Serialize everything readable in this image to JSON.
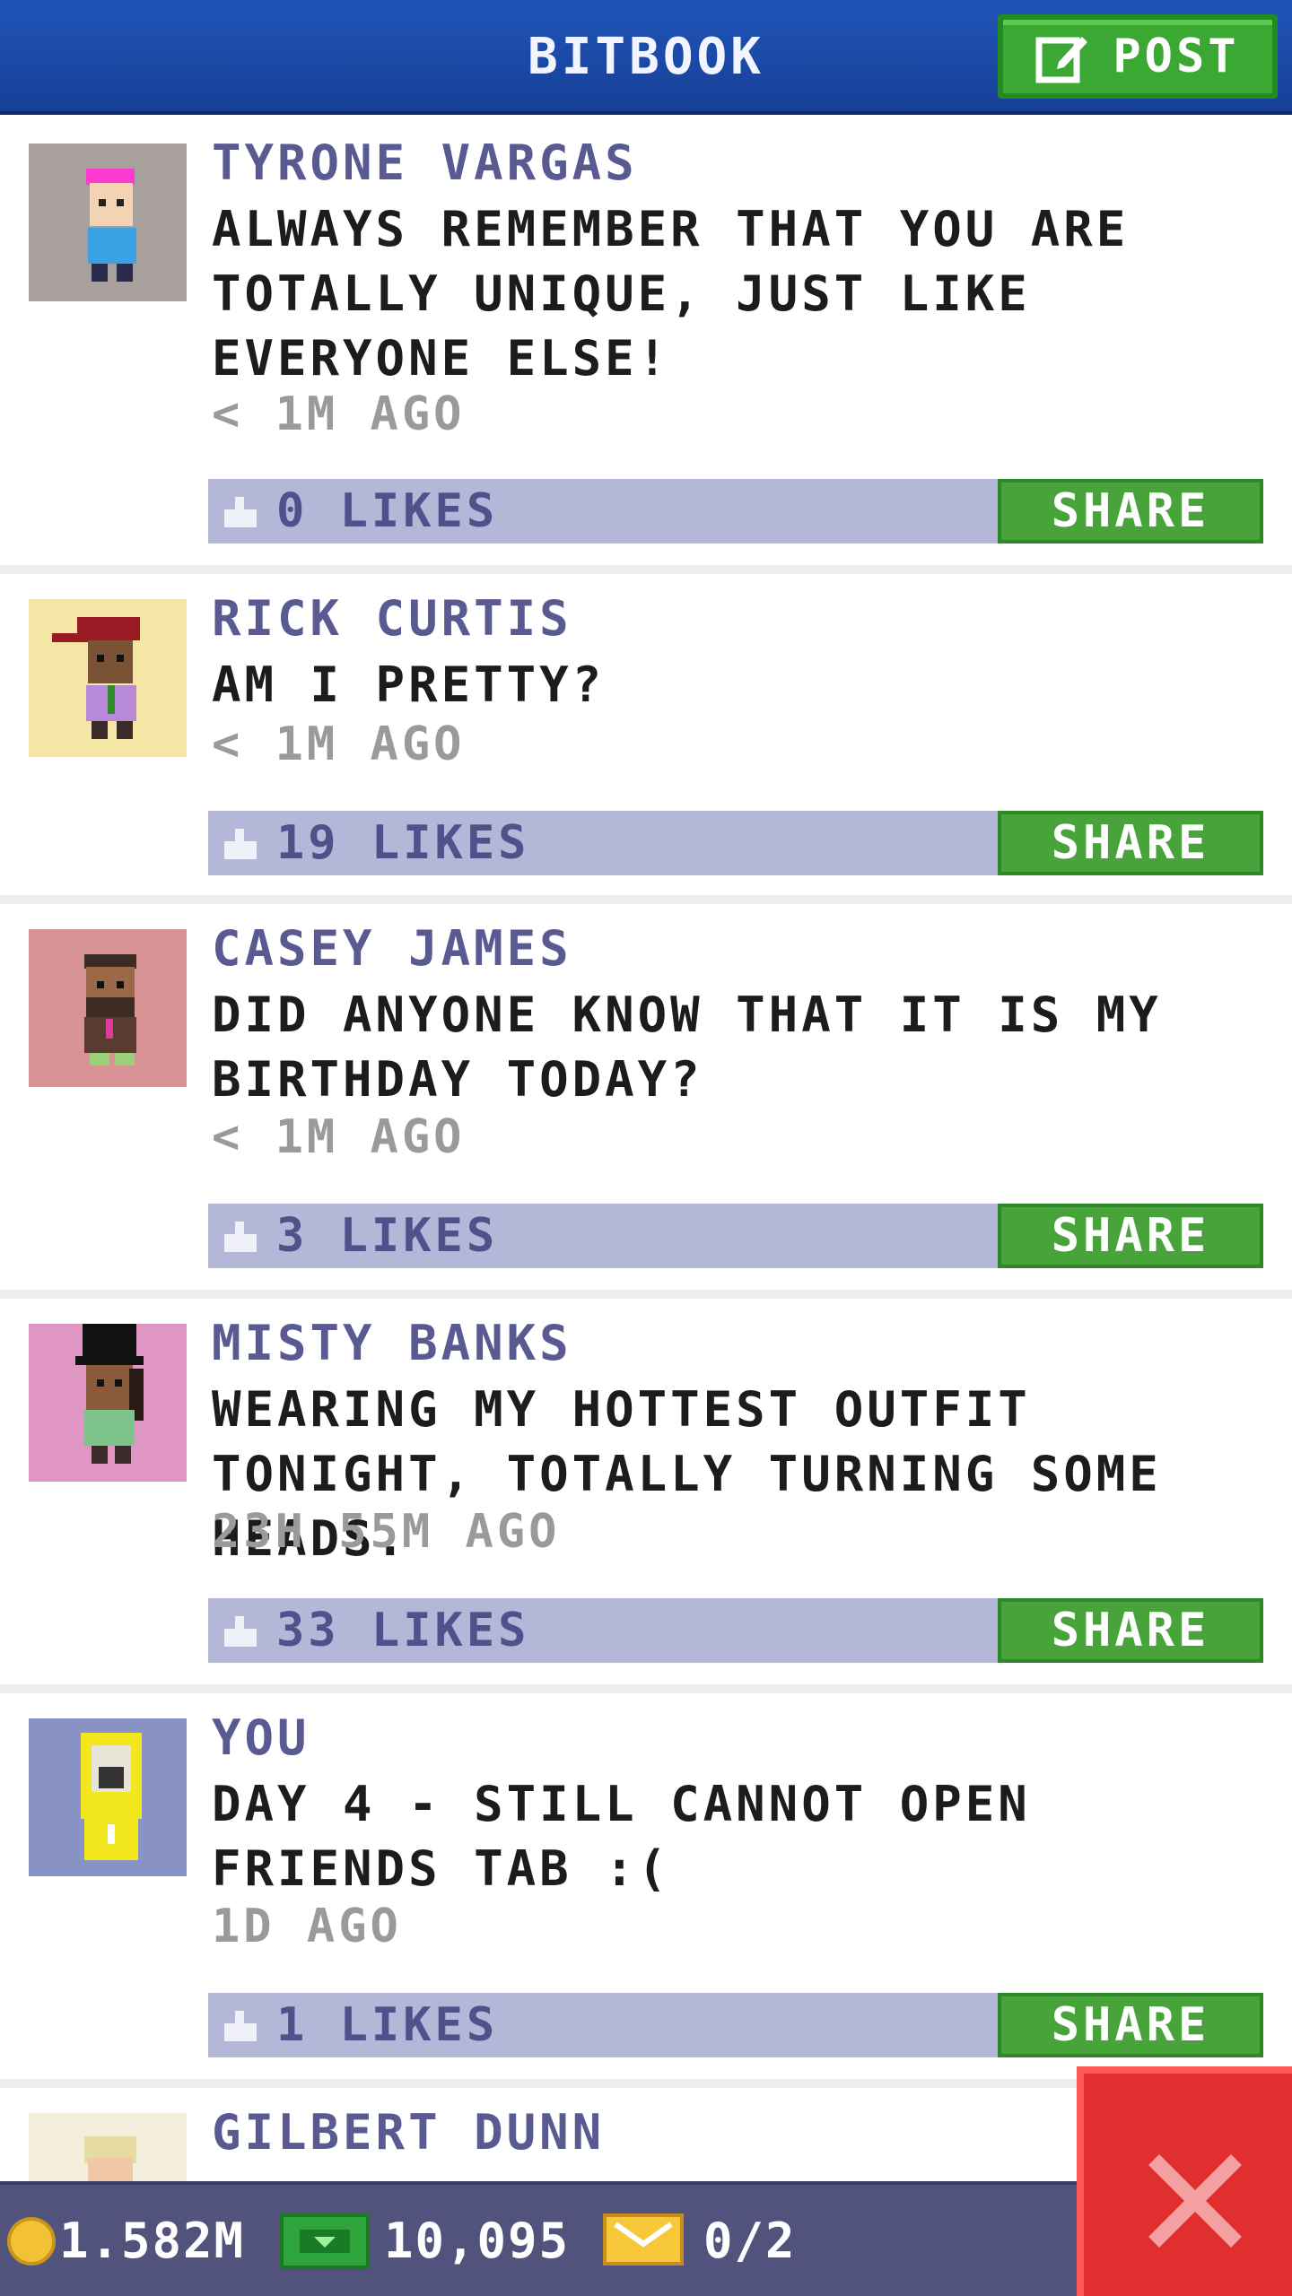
{
  "header": {
    "title": "BITBOOK",
    "post_label": "POST"
  },
  "posts": [
    {
      "author": "TYRONE VARGAS",
      "message": "ALWAYS REMEMBER THAT YOU ARE TOTALLY UNIQUE, JUST LIKE EVERYONE ELSE!",
      "time": "< 1M AGO",
      "likes": "0 LIKES",
      "share_label": "SHARE",
      "avatar_bg": "#a8a09c"
    },
    {
      "author": "RICK CURTIS",
      "message": "AM I PRETTY?",
      "time": "< 1M AGO",
      "likes": "19 LIKES",
      "share_label": "SHARE",
      "avatar_bg": "#f6e6a6"
    },
    {
      "author": "CASEY JAMES",
      "message": "DID ANYONE KNOW THAT IT IS MY BIRTHDAY TODAY?",
      "time": "< 1M AGO",
      "likes": "3 LIKES",
      "share_label": "SHARE",
      "avatar_bg": "#d89494"
    },
    {
      "author": "MISTY BANKS",
      "message": "WEARING MY HOTTEST OUTFIT TONIGHT, TOTALLY TURNING SOME HEADS.",
      "time": "23H 55M AGO",
      "likes": "33 LIKES",
      "share_label": "SHARE",
      "avatar_bg": "#e096c2"
    },
    {
      "author": "YOU",
      "message": "DAY 4 - STILL CANNOT OPEN FRIENDS TAB :(",
      "time": "1D AGO",
      "likes": "1 LIKES",
      "share_label": "SHARE",
      "avatar_bg": "#8892c4"
    },
    {
      "author": "GILBERT DUNN",
      "avatar_bg": "#f4eedc"
    }
  ],
  "status_bar": {
    "coins": "1.582M",
    "bux": "10,095",
    "tickets": "0/2"
  },
  "colors": {
    "header": "#1f55b8",
    "share_green": "#48a43a",
    "like_bar": "#b4b7d8",
    "close_red": "#e12f2f"
  },
  "icons": {
    "post": "edit-icon",
    "like": "thumbs-up-icon",
    "close": "close-icon",
    "coin": "coin-icon",
    "bux": "bux-icon",
    "ticket": "ticket-icon"
  }
}
